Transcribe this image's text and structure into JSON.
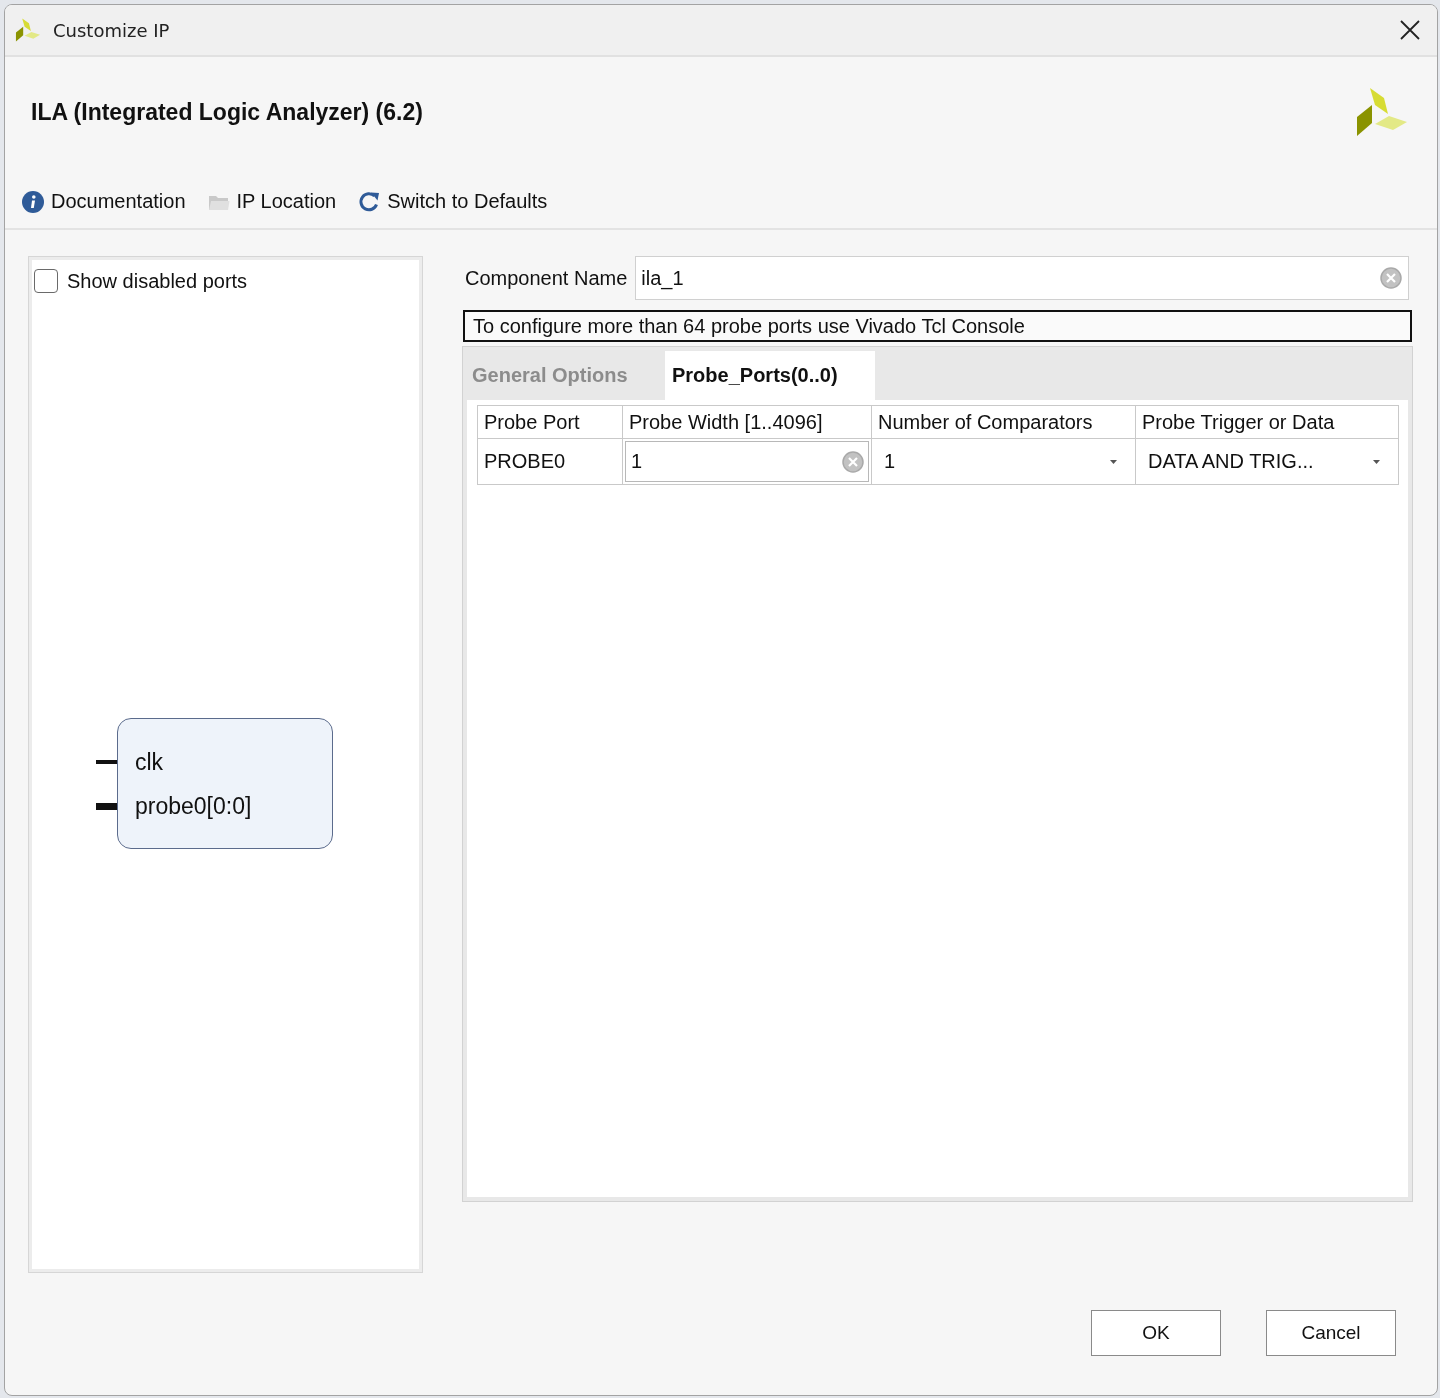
{
  "window": {
    "title": "Customize IP"
  },
  "header": {
    "title": "ILA (Integrated Logic Analyzer) (6.2)"
  },
  "toolbar": [
    {
      "kind": "info",
      "label": "Documentation"
    },
    {
      "kind": "folder",
      "label": "IP Location"
    },
    {
      "kind": "refresh",
      "label": "Switch to Defaults"
    }
  ],
  "symbol_panel": {
    "show_disabled_ports": {
      "label": "Show disabled ports",
      "checked": false
    },
    "ports": [
      {
        "name": "clk",
        "kind": "single"
      },
      {
        "name": "probe0[0:0]",
        "kind": "bus"
      }
    ]
  },
  "component_name": {
    "label": "Component Name",
    "value": "ila_1"
  },
  "notice": "To configure more than 64 probe ports use Vivado Tcl Console",
  "tabs": [
    {
      "label": "General Options",
      "selected": false
    },
    {
      "label": "Probe_Ports(0..0)",
      "selected": true
    }
  ],
  "table": {
    "columns": [
      "Probe Port",
      "Probe Width [1..4096]",
      "Number of Comparators",
      "Probe Trigger or Data"
    ],
    "rows": [
      {
        "cells": [
          {
            "kind": "text",
            "value": "PROBE0"
          },
          {
            "kind": "input",
            "value": "1"
          },
          {
            "kind": "select",
            "value": "1"
          },
          {
            "kind": "select",
            "value": "DATA AND TRIG..."
          }
        ]
      }
    ]
  },
  "buttons": [
    {
      "label": "OK"
    },
    {
      "label": "Cancel"
    }
  ]
}
